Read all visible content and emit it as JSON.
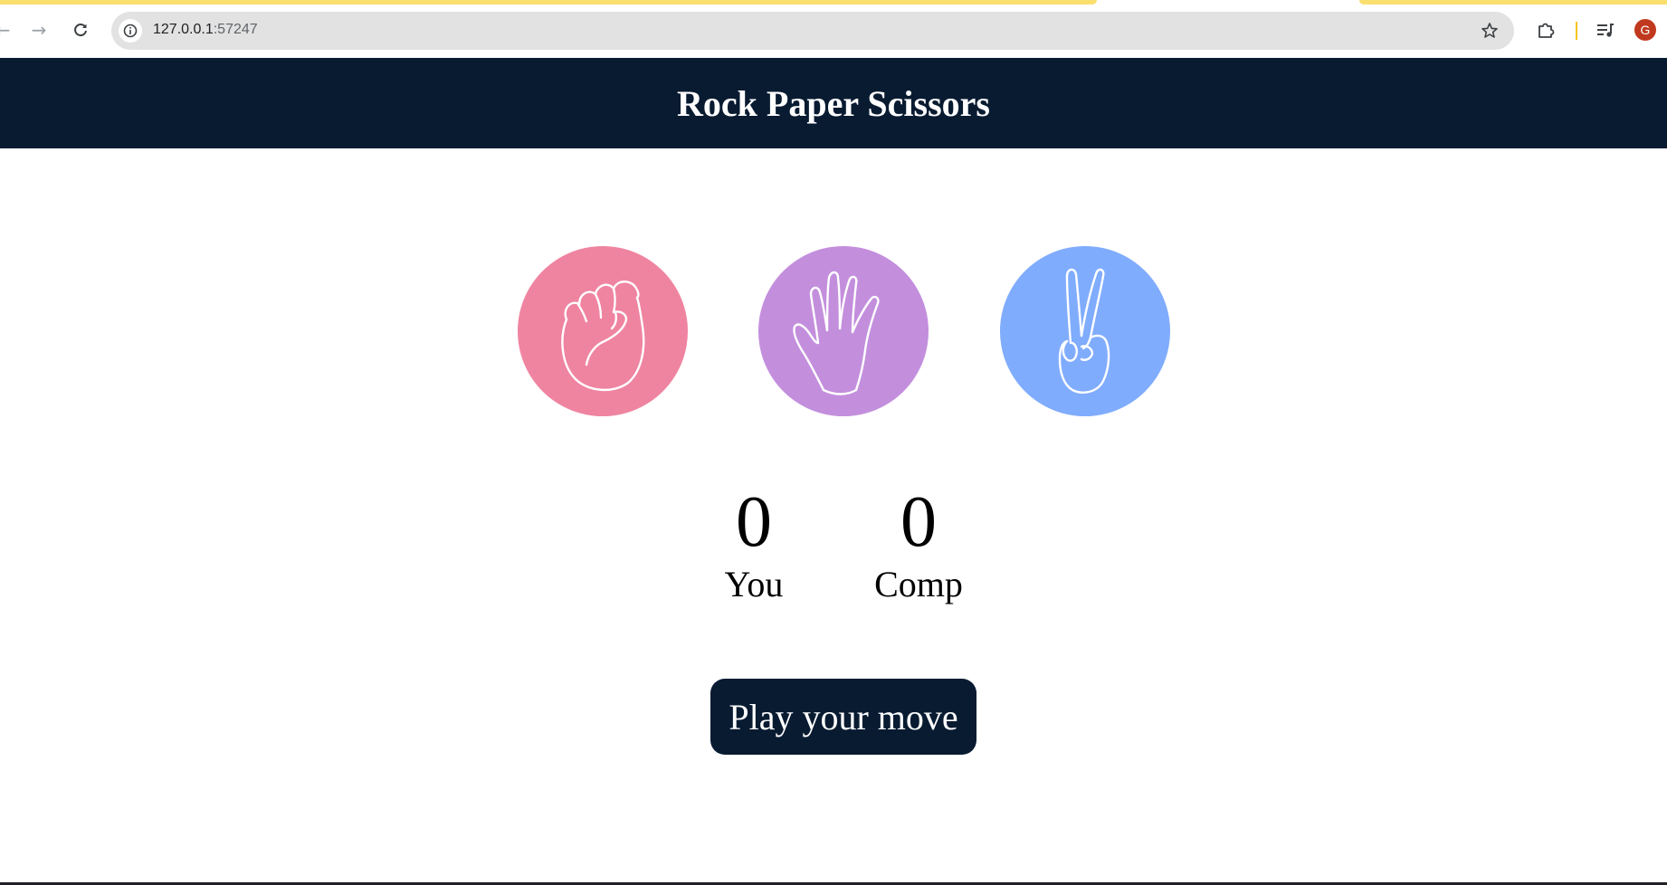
{
  "browser": {
    "url_host": "127.0.0.1",
    "url_port": ":57247",
    "profile_initial": "G",
    "accent_color": "#f9df6e"
  },
  "page": {
    "title": "Rock Paper Scissors",
    "header_color": "#081b31",
    "choices": [
      {
        "name": "rock",
        "icon": "fist-icon",
        "color": "#ef84a0"
      },
      {
        "name": "paper",
        "icon": "open-hand-icon",
        "color": "#c38fdd"
      },
      {
        "name": "scissors",
        "icon": "peace-hand-icon",
        "color": "#80acfd"
      }
    ],
    "score": {
      "you_value": "0",
      "you_label": "You",
      "comp_value": "0",
      "comp_label": "Comp"
    },
    "play_button_label": "Play your move"
  }
}
